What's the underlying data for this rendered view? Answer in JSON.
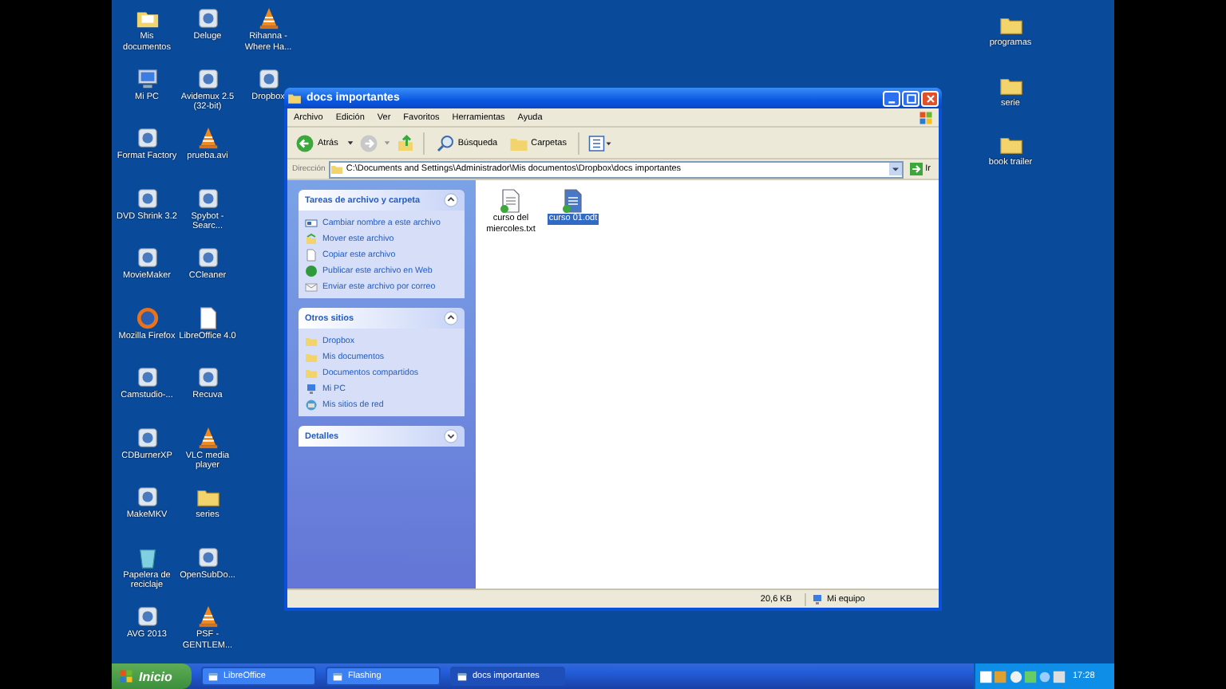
{
  "desktop": {
    "columns": [
      [
        {
          "label": "Mis documentos",
          "kind": "docs"
        },
        {
          "label": "Mi PC",
          "kind": "pc"
        },
        {
          "label": "Format Factory",
          "kind": "app"
        },
        {
          "label": "DVD Shrink 3.2",
          "kind": "app"
        },
        {
          "label": "MovieMaker",
          "kind": "app"
        },
        {
          "label": "Mozilla Firefox",
          "kind": "globe"
        },
        {
          "label": "Camstudio-...",
          "kind": "app"
        },
        {
          "label": "CDBurnerXP",
          "kind": "app"
        },
        {
          "label": "MakeMKV",
          "kind": "app"
        },
        {
          "label": "Papelera de reciclaje",
          "kind": "bin"
        },
        {
          "label": "AVG 2013",
          "kind": "app"
        }
      ],
      [
        {
          "label": "Deluge",
          "kind": "app"
        },
        {
          "label": "Avidemux 2.5 (32-bit)",
          "kind": "app"
        },
        {
          "label": "prueba.avi",
          "kind": "cone"
        },
        {
          "label": "Spybot - Searc...",
          "kind": "app"
        },
        {
          "label": "CCleaner",
          "kind": "app"
        },
        {
          "label": "LibreOffice 4.0",
          "kind": "doc"
        },
        {
          "label": "Recuva",
          "kind": "app"
        },
        {
          "label": "VLC media player",
          "kind": "cone"
        },
        {
          "label": "series",
          "kind": "folder"
        },
        {
          "label": "OpenSubDo...",
          "kind": "app"
        },
        {
          "label": "PSF - GENTLEM...",
          "kind": "cone"
        }
      ],
      [
        {
          "label": "Rihanna - Where Ha...",
          "kind": "cone"
        },
        {
          "label": "Dropbox",
          "kind": "app"
        }
      ]
    ],
    "right_column": [
      {
        "label": "programas",
        "kind": "folder"
      },
      {
        "label": "serie",
        "kind": "folder"
      },
      {
        "label": "book trailer",
        "kind": "folder"
      }
    ]
  },
  "window": {
    "title": "docs importantes",
    "menu": [
      "Archivo",
      "Edición",
      "Ver",
      "Favoritos",
      "Herramientas",
      "Ayuda"
    ],
    "toolbar": {
      "back": "Atrás",
      "search": "Búsqueda",
      "folders": "Carpetas"
    },
    "address": {
      "label": "Dirección",
      "value": "C:\\Documents and Settings\\Administrador\\Mis documentos\\Dropbox\\docs importantes",
      "go": "Ir"
    },
    "panels": [
      {
        "title": "Tareas de archivo y carpeta",
        "expanded": true,
        "items": [
          {
            "label": "Cambiar nombre a este archivo",
            "kind": "rename"
          },
          {
            "label": "Mover este archivo",
            "kind": "move"
          },
          {
            "label": "Copiar este archivo",
            "kind": "doc"
          },
          {
            "label": "Publicar este archivo en Web",
            "kind": "globe"
          },
          {
            "label": "Enviar este archivo por correo",
            "kind": "mail"
          }
        ]
      },
      {
        "title": "Otros sitios",
        "expanded": true,
        "items": [
          {
            "label": "Dropbox",
            "kind": "folder"
          },
          {
            "label": "Mis documentos",
            "kind": "folder"
          },
          {
            "label": "Documentos compartidos",
            "kind": "folder"
          },
          {
            "label": "Mi PC",
            "kind": "pc"
          },
          {
            "label": "Mis sitios de red",
            "kind": "net"
          }
        ]
      },
      {
        "title": "Detalles",
        "expanded": false
      }
    ],
    "files": [
      {
        "name": "curso del miercoles.txt",
        "kind": "doc",
        "selected": false
      },
      {
        "name": "curso 01.odt",
        "kind": "odt",
        "selected": true
      }
    ],
    "status_bar": {
      "size": "20,6 KB",
      "location": "Mi equipo"
    }
  },
  "taskbar": {
    "start": "Inicio",
    "tasks": [
      {
        "label": "LibreOffice",
        "selected": false
      },
      {
        "label": "Flashing",
        "selected": false
      },
      {
        "label": "docs importantes",
        "selected": true
      }
    ],
    "clock": "17:28"
  }
}
